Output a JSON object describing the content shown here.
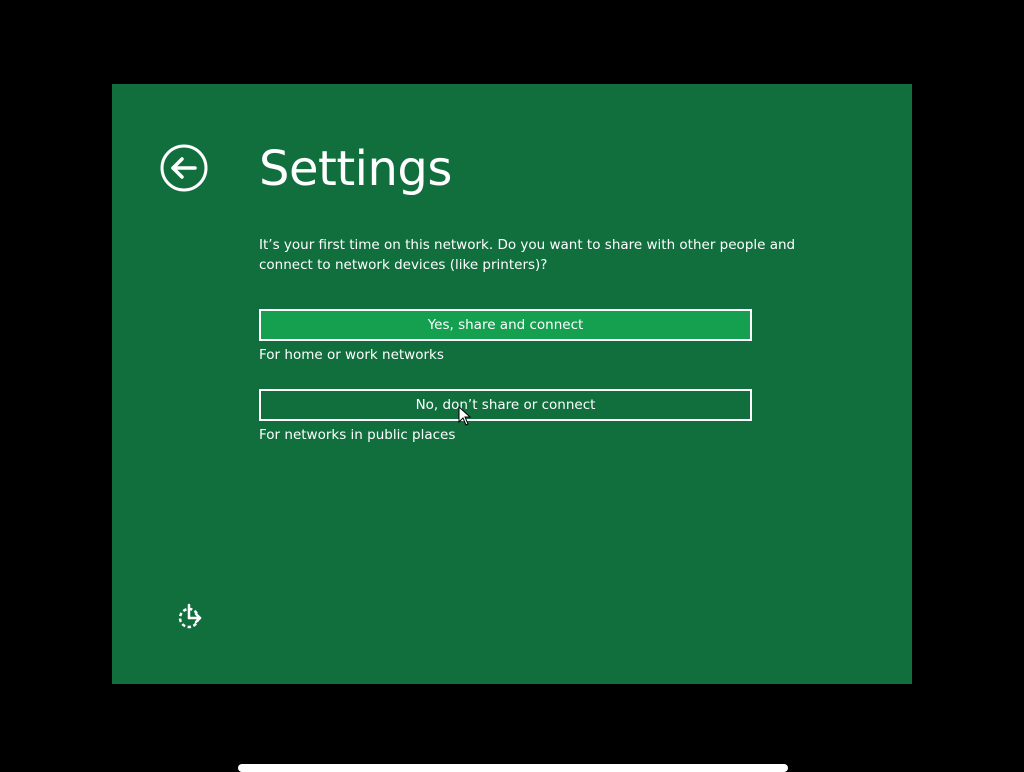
{
  "page": {
    "title": "Settings"
  },
  "question": "It’s your first time on this network. Do you want to share with other people and connect to network devices (like printers)?",
  "options": [
    {
      "label": "Yes, share and connect",
      "description": "For home or work networks"
    },
    {
      "label": "No, don’t share or connect",
      "description": "For networks in public places"
    }
  ],
  "icons": {
    "back": "back-arrow-circle-icon",
    "ease_of_access": "ease-of-access-icon",
    "cursor": "mouse-cursor-icon"
  },
  "colors": {
    "background": "#116f3e",
    "selected_button": "#15a050",
    "outer": "#000000",
    "text": "#ffffff"
  }
}
